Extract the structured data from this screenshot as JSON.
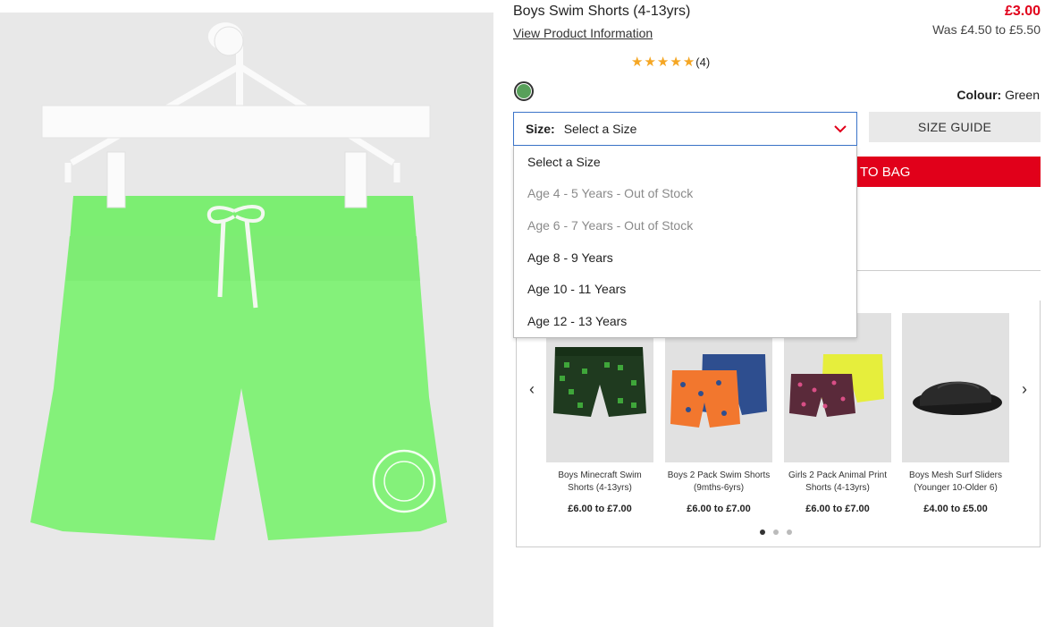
{
  "product": {
    "title": "Boys Swim Shorts (4-13yrs)",
    "view_info": "View Product Information",
    "price_now": "£3.00",
    "price_was": "Was £4.50 to £5.50",
    "rating_stars": 5,
    "rating_count": "(4)",
    "colour_label": "Colour:",
    "colour_value": "Green",
    "swatch_color": "#58a05a"
  },
  "size": {
    "label": "Size:",
    "value": "Select a Size",
    "guide": "SIZE GUIDE",
    "options": [
      {
        "label": "Select a Size",
        "in_stock": true
      },
      {
        "label": "Age 4 - 5 Years - Out of Stock",
        "in_stock": false
      },
      {
        "label": "Age 6 - 7 Years - Out of Stock",
        "in_stock": false
      },
      {
        "label": "Age 8 - 9 Years",
        "in_stock": true
      },
      {
        "label": "Age 10 - 11 Years",
        "in_stock": true
      },
      {
        "label": "Age 12 - 13 Years",
        "in_stock": true
      }
    ]
  },
  "add_to_bag": "TO BAG",
  "colors": {
    "accent_red": "#e1001a",
    "select_border": "#3b74c9",
    "shorts_green": "#7cee72"
  },
  "recommendations": {
    "items": [
      {
        "name_line1": "Boys Minecraft Swim",
        "name_line2": "Shorts (4-13yrs)",
        "price": "£6.00 to £7.00"
      },
      {
        "name_line1": "Boys 2 Pack Swim Shorts",
        "name_line2": "(9mths-6yrs)",
        "price": "£6.00 to £7.00"
      },
      {
        "name_line1": "Girls 2 Pack Animal Print",
        "name_line2": "Shorts (4-13yrs)",
        "price": "£6.00 to £7.00"
      },
      {
        "name_line1": "Boys Mesh Surf Sliders",
        "name_line2": "(Younger 10-Older 6)",
        "price": "£4.00 to £5.00"
      }
    ],
    "page": 1,
    "pages": 3
  }
}
